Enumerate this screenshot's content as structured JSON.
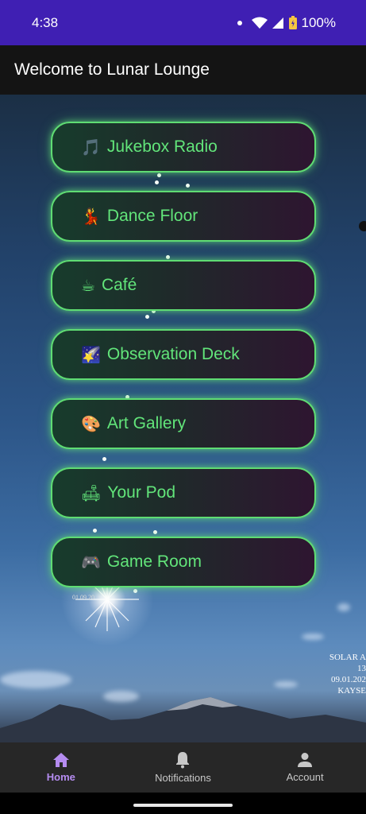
{
  "status": {
    "time": "4:38",
    "battery": "100%"
  },
  "app_bar": {
    "title": "Welcome to Lunar Lounge"
  },
  "menu": [
    {
      "emoji": "🎵",
      "label": "Jukebox Radio",
      "icon": "musical-note-icon"
    },
    {
      "emoji": "💃",
      "label": "Dance Floor",
      "icon": "dancer-icon"
    },
    {
      "emoji": "☕",
      "label": "Café",
      "icon": "coffee-icon"
    },
    {
      "emoji": "🌠",
      "label": "Observation Deck",
      "icon": "shooting-star-icon"
    },
    {
      "emoji": "🎨",
      "label": "Art Gallery",
      "icon": "palette-icon"
    },
    {
      "emoji": "🛋",
      "label": "Your Pod",
      "icon": "couch-lamp-icon"
    },
    {
      "emoji": "🎮",
      "label": "Game Room",
      "icon": "game-controller-icon"
    }
  ],
  "background_caption": {
    "lines": [
      "SOLAR A",
      "13",
      "09.01.202",
      "KAYSE"
    ],
    "small_date": "01.09.20"
  },
  "bottom_nav": {
    "items": [
      {
        "label": "Home",
        "icon": "home-icon",
        "active": true
      },
      {
        "label": "Notifications",
        "icon": "bell-icon",
        "active": false
      },
      {
        "label": "Account",
        "icon": "person-icon",
        "active": false
      }
    ]
  },
  "colors": {
    "status_bar": "#3f1fb3",
    "app_bar": "#141414",
    "button_border": "#5fdc73",
    "button_text": "#62e57a",
    "nav_active": "#b58cf0",
    "nav_inactive": "#c8c8c8"
  }
}
